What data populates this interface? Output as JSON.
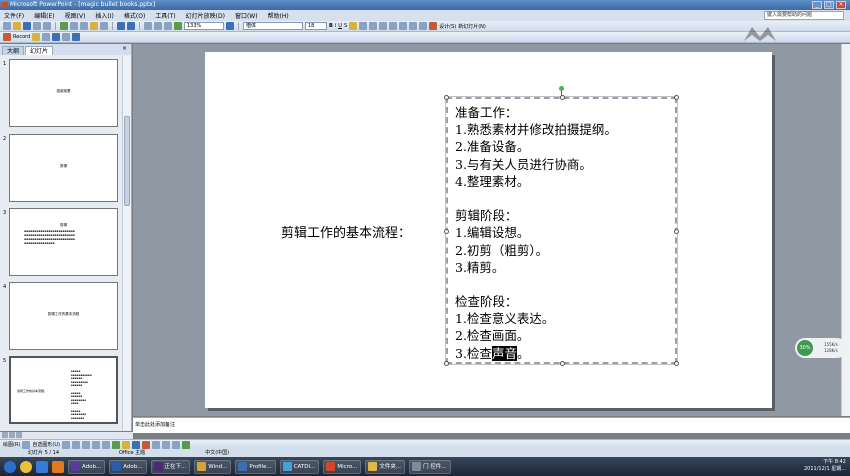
{
  "window": {
    "title": "Microsoft PowerPoint - [magic bullet books.pptx]"
  },
  "menu": {
    "items": [
      "文件(F)",
      "编辑(E)",
      "视图(V)",
      "插入(I)",
      "格式(O)",
      "工具(T)",
      "幻灯片放映(D)",
      "窗口(W)",
      "帮助(H)"
    ],
    "help_placeholder": "键入需要帮助的问题"
  },
  "toolbar": {
    "zoom": "133%",
    "font_name": "楷体",
    "font_size": "18",
    "design_label": "设计(S)",
    "new_slide_label": "新幻灯片(N)",
    "record_label": "Record"
  },
  "panel": {
    "tabs": [
      "大纲",
      "幻灯片"
    ],
    "close": "×"
  },
  "thumbnails": [
    {
      "num": "1",
      "text": "感谢观看"
    },
    {
      "num": "2",
      "text": "剪辑"
    },
    {
      "num": "3",
      "text": "剪辑"
    },
    {
      "num": "4",
      "text": "剪辑工作的基本流程"
    },
    {
      "num": "5",
      "text": "剪辑工作的基本流程："
    }
  ],
  "slide": {
    "title": "剪辑工作的基本流程：",
    "lines": [
      "准备工作：",
      "1.熟悉素材并修改拍摄提纲。",
      "2.准备设备。",
      "3.与有关人员进行协商。",
      "4.整理素材。",
      "",
      "剪辑阶段：",
      "1.编辑设想。",
      "2.初剪（粗剪）。",
      "3.精剪。",
      "",
      "检查阶段：",
      "1.检查意义表达。",
      "2.检查画面。"
    ],
    "last_line_prefix": "3.检查",
    "last_line_selected": "声音",
    "last_line_suffix": "。"
  },
  "notes": {
    "placeholder": "单击此处添加备注"
  },
  "drawbar": {
    "draw_label": "绘图(R)",
    "autoshape_label": "自选图形(U)"
  },
  "status": {
    "slide_info": "幻灯片 5 / 14",
    "theme": "Office 主题",
    "language": "中文(中国)"
  },
  "taskbar": {
    "buttons": [
      "Adob...",
      "Adob...",
      "正在下...",
      "Wind...",
      "Profile...",
      "CATDI...",
      "Micro...",
      "文件夹...",
      "门 控件..."
    ],
    "time": "下午 8:42",
    "date": "2011/12/1 星期..."
  },
  "net": {
    "percent": "30%",
    "up": "155K/s",
    "down": "128K/s"
  }
}
